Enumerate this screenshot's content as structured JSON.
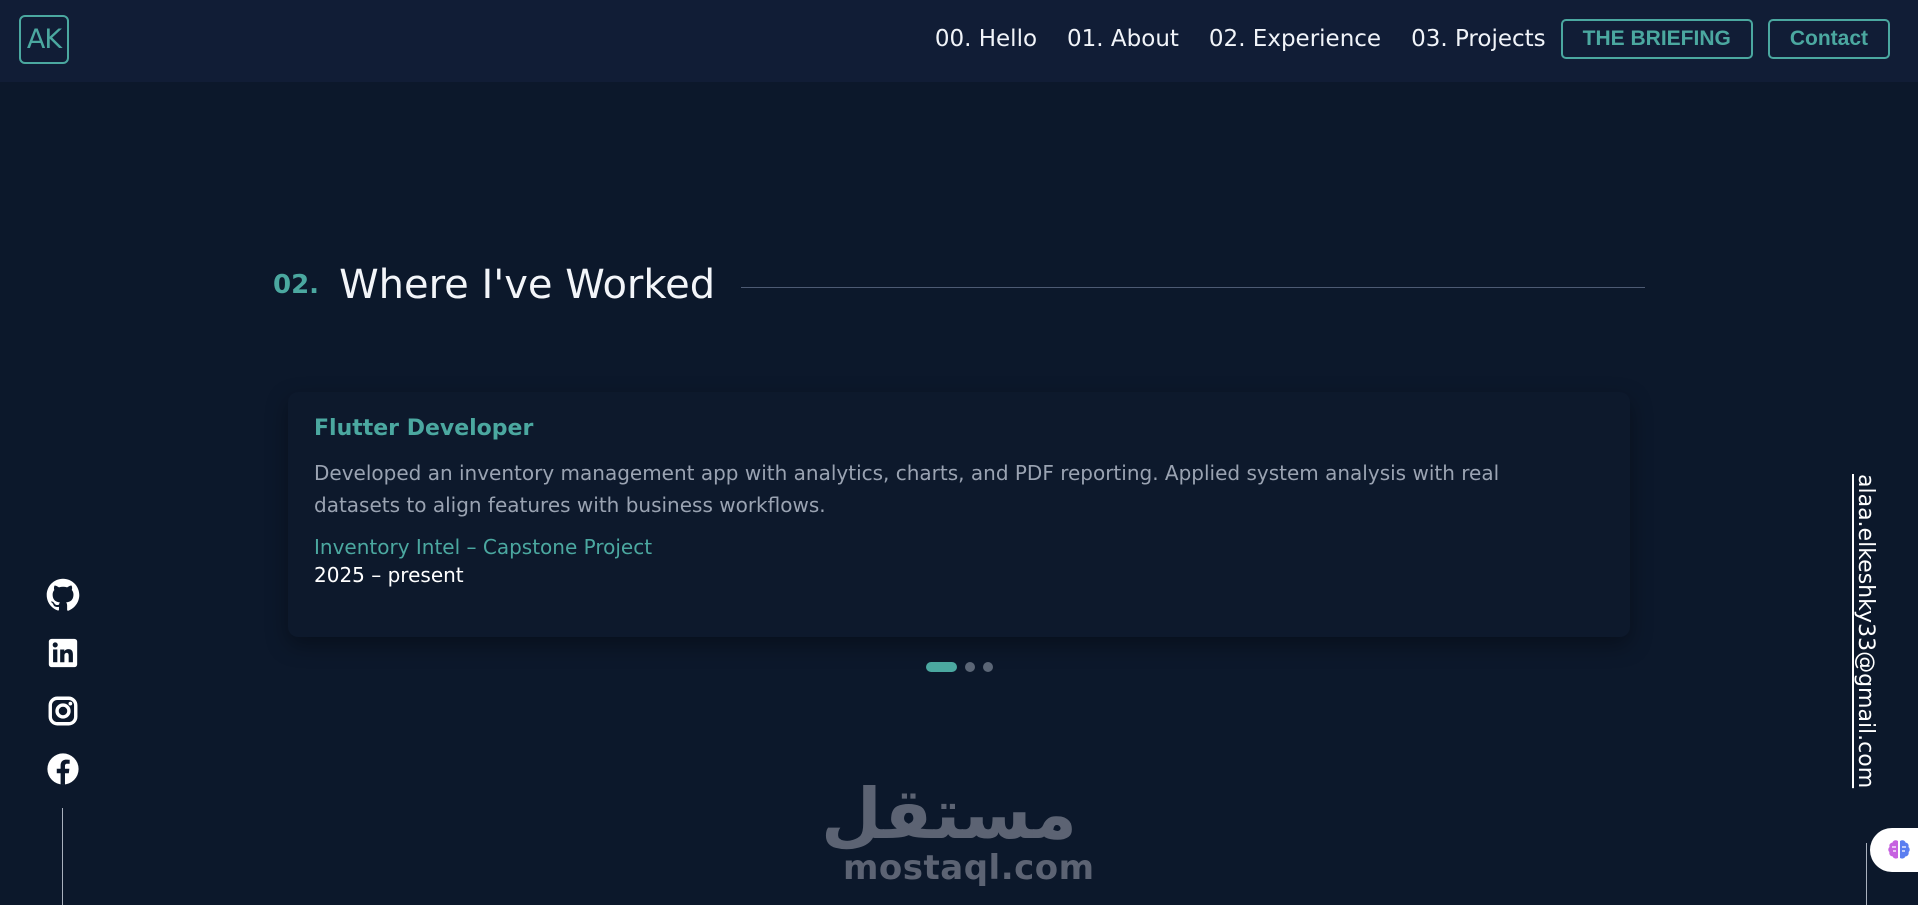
{
  "header": {
    "logo_text": "AK",
    "nav": [
      {
        "label": "00. Hello"
      },
      {
        "label": "01. About"
      },
      {
        "label": "02. Experience"
      },
      {
        "label": "03. Projects"
      }
    ],
    "briefing_label": "THE BRIEFING",
    "contact_label": "Contact"
  },
  "section": {
    "number": "02.",
    "title": "Where I've Worked"
  },
  "experience": {
    "title": "Flutter Developer",
    "description": "Developed an inventory management app with analytics, charts, and PDF reporting. Applied system analysis with real datasets to align features with business workflows.",
    "company": "Inventory Intel – Capstone Project",
    "dates": "2025 – present"
  },
  "pagination": {
    "count": 3,
    "active": 1
  },
  "socials": [
    {
      "icon": "github-icon"
    },
    {
      "icon": "linkedin-icon"
    },
    {
      "icon": "instagram-icon"
    },
    {
      "icon": "facebook-icon"
    }
  ],
  "email": "alaa.elkeshky33@gmail.com",
  "watermark": {
    "arabic": "مستقل",
    "latin": "mostaql.com"
  },
  "colors": {
    "background": "#0c182b",
    "header": "#111d36",
    "accent": "#4ba8a0"
  }
}
